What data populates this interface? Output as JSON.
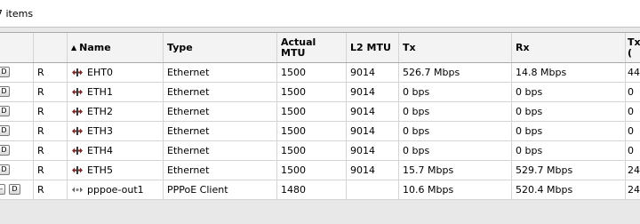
{
  "toolbar": {
    "item_count": "7 items"
  },
  "columns": {
    "name": "Name",
    "type": "Type",
    "actual_mtu": "Actual MTU",
    "l2_mtu": "L2 MTU",
    "tx": "Tx",
    "rx": "Rx",
    "extra": "Tx ("
  },
  "buttons": {
    "d": "D",
    "minus": "-"
  },
  "rows": [
    {
      "flag": "R",
      "name": "EHT0",
      "type": "Ethernet",
      "actual_mtu": "1500",
      "l2_mtu": "9014",
      "tx": "526.7 Mbps",
      "rx": "14.8 Mbps",
      "extra": "44",
      "icon": "ethernet-icon"
    },
    {
      "flag": "R",
      "name": "ETH1",
      "type": "Ethernet",
      "actual_mtu": "1500",
      "l2_mtu": "9014",
      "tx": "0 bps",
      "rx": "0 bps",
      "extra": "0",
      "icon": "ethernet-icon"
    },
    {
      "flag": "R",
      "name": "ETH2",
      "type": "Ethernet",
      "actual_mtu": "1500",
      "l2_mtu": "9014",
      "tx": "0 bps",
      "rx": "0 bps",
      "extra": "0",
      "icon": "ethernet-icon"
    },
    {
      "flag": "R",
      "name": "ETH3",
      "type": "Ethernet",
      "actual_mtu": "1500",
      "l2_mtu": "9014",
      "tx": "0 bps",
      "rx": "0 bps",
      "extra": "0",
      "icon": "ethernet-icon"
    },
    {
      "flag": "R",
      "name": "ETH4",
      "type": "Ethernet",
      "actual_mtu": "1500",
      "l2_mtu": "9014",
      "tx": "0 bps",
      "rx": "0 bps",
      "extra": "0",
      "icon": "ethernet-icon"
    },
    {
      "flag": "R",
      "name": "ETH5",
      "type": "Ethernet",
      "actual_mtu": "1500",
      "l2_mtu": "9014",
      "tx": "15.7 Mbps",
      "rx": "529.7 Mbps",
      "extra": "24",
      "icon": "ethernet-icon"
    },
    {
      "flag": "R",
      "name": "pppoe-out1",
      "type": "PPPoE Client",
      "actual_mtu": "1480",
      "l2_mtu": "",
      "tx": "10.6 Mbps",
      "rx": "520.4 Mbps",
      "extra": "24",
      "icon": "pppoe-icon"
    }
  ]
}
